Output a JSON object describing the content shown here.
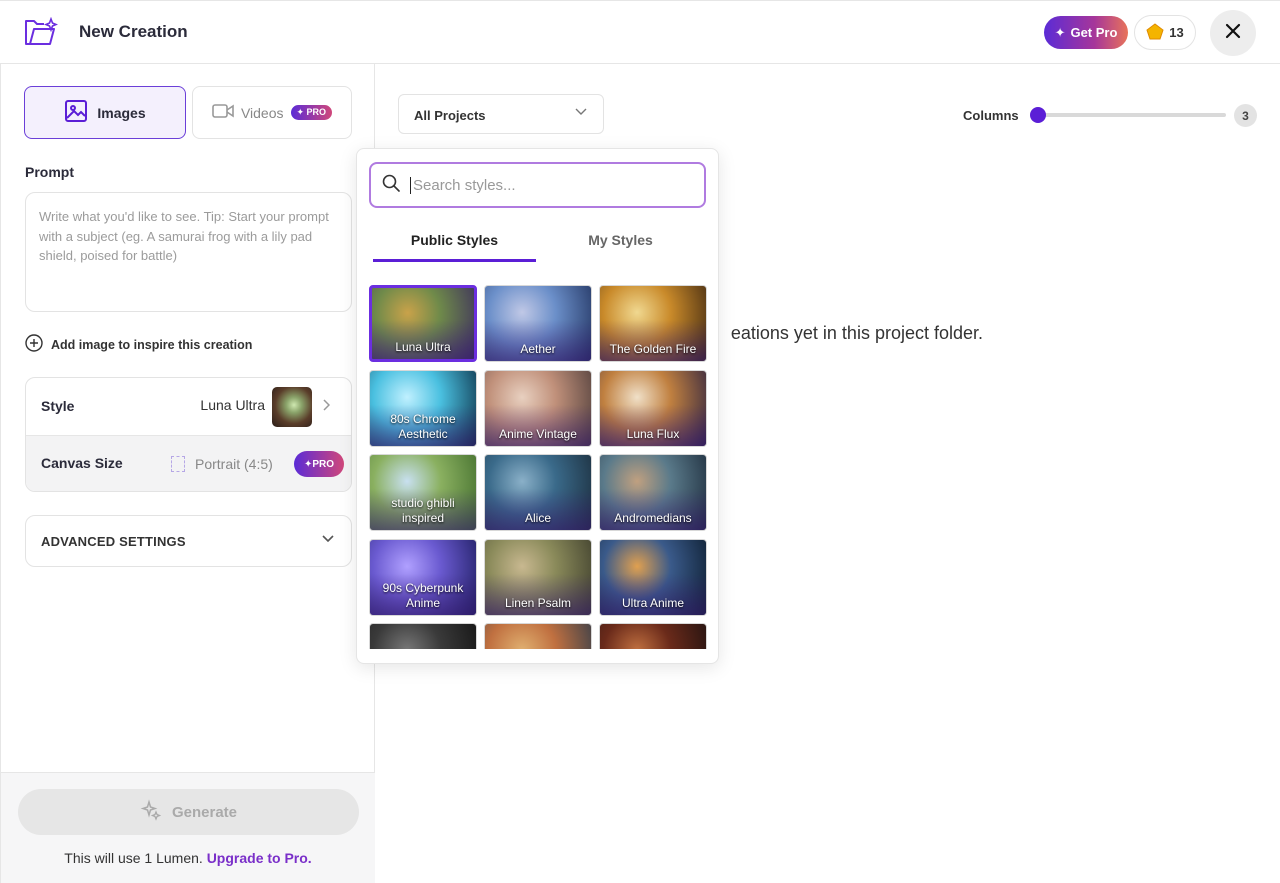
{
  "header": {
    "title": "New Creation",
    "get_pro_label": "Get Pro",
    "lumen_count": "13"
  },
  "left_panel": {
    "tabs": [
      {
        "label": "Images",
        "icon": "image-icon",
        "active": true
      },
      {
        "label": "Videos",
        "icon": "video-icon",
        "badge": "PRO",
        "active": false
      }
    ],
    "prompt": {
      "label": "Prompt",
      "placeholder": "Write what you'd like to see.  Tip: Start your prompt with a subject (eg. A samurai frog with a lily pad shield, poised for battle)"
    },
    "add_image_label": "Add image to inspire this creation",
    "style": {
      "label": "Style",
      "value": "Luna Ultra"
    },
    "canvas": {
      "label": "Canvas Size",
      "value": "Portrait (4:5)",
      "badge": "PRO"
    },
    "advanced_label": "ADVANCED SETTINGS",
    "generate_label": "Generate",
    "footer_text": "This will use 1 Lumen.",
    "upgrade_link": "Upgrade to Pro."
  },
  "main": {
    "project_select": "All Projects",
    "columns_label": "Columns",
    "columns_value": "3",
    "empty_message": "eations yet in this project folder."
  },
  "style_picker": {
    "search_placeholder": "Search styles...",
    "tabs": [
      "Public Styles",
      "My Styles"
    ],
    "active_tab": 0,
    "styles": [
      {
        "name": "Luna Ultra",
        "selected": true,
        "colors": [
          "#3a2a5e",
          "#6f8a4a",
          "#c9a24a"
        ]
      },
      {
        "name": "Aether",
        "selected": false,
        "colors": [
          "#1d2e5a",
          "#6b8fc9",
          "#c0c8e6"
        ]
      },
      {
        "name": "The Golden Fire",
        "selected": false,
        "colors": [
          "#3a2410",
          "#c98a2a",
          "#f0d890"
        ]
      },
      {
        "name": "80s Chrome Aesthetic",
        "selected": false,
        "colors": [
          "#0a2a40",
          "#4ac0e0",
          "#c0f0ff"
        ]
      },
      {
        "name": "Anime Vintage",
        "selected": false,
        "colors": [
          "#4a3a38",
          "#c0907a",
          "#e8d0c0"
        ]
      },
      {
        "name": "Luna Flux",
        "selected": false,
        "colors": [
          "#2a2040",
          "#c08040",
          "#f0e0c8"
        ]
      },
      {
        "name": "studio ghibli inspired",
        "selected": false,
        "colors": [
          "#3e6a2a",
          "#8ab060",
          "#c8e0f0"
        ]
      },
      {
        "name": "Alice",
        "selected": false,
        "colors": [
          "#1a2a38",
          "#3a6a8a",
          "#8ab0c8"
        ]
      },
      {
        "name": "Andromedians",
        "selected": false,
        "colors": [
          "#1a2838",
          "#5a7a8a",
          "#c0a080"
        ]
      },
      {
        "name": "90s Cyberpunk Anime",
        "selected": false,
        "colors": [
          "#1a1a5a",
          "#6a5ad0",
          "#b0a0ff"
        ]
      },
      {
        "name": "Linen Psalm",
        "selected": false,
        "colors": [
          "#3a3a2a",
          "#8a8a5a",
          "#c8b890"
        ]
      },
      {
        "name": "Ultra Anime",
        "selected": false,
        "colors": [
          "#0a1a2a",
          "#3a5a8a",
          "#e0a050"
        ]
      },
      {
        "name": "",
        "selected": false,
        "colors": [
          "#111111",
          "#3a3a3a",
          "#777777"
        ]
      },
      {
        "name": "",
        "selected": false,
        "colors": [
          "#2a3a4a",
          "#c07040",
          "#e0b070"
        ]
      },
      {
        "name": "",
        "selected": false,
        "colors": [
          "#1a1010",
          "#6a2a1a",
          "#c07040"
        ]
      }
    ]
  },
  "colors": {
    "accent": "#5b1ed6",
    "link": "#7a2fc9",
    "active_border": "#6b3fd8"
  }
}
